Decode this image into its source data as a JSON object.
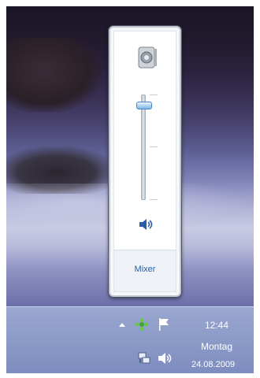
{
  "volume_flyout": {
    "device_icon": "speaker-device-icon",
    "volume_level": 0.93,
    "mute_button_icon": "speaker-sound-icon",
    "mixer_label": "Mixer"
  },
  "taskbar": {
    "tray_icons": [
      "show-hidden-icons-arrow",
      "green-flower-icon",
      "action-center-flag-icon",
      "network-icon",
      "volume-icon"
    ],
    "clock": {
      "time": "12:44",
      "day": "Montag",
      "date": "24.08.2009"
    }
  },
  "colors": {
    "link": "#2a5ea8",
    "accent_blue": "#4d86bf"
  }
}
